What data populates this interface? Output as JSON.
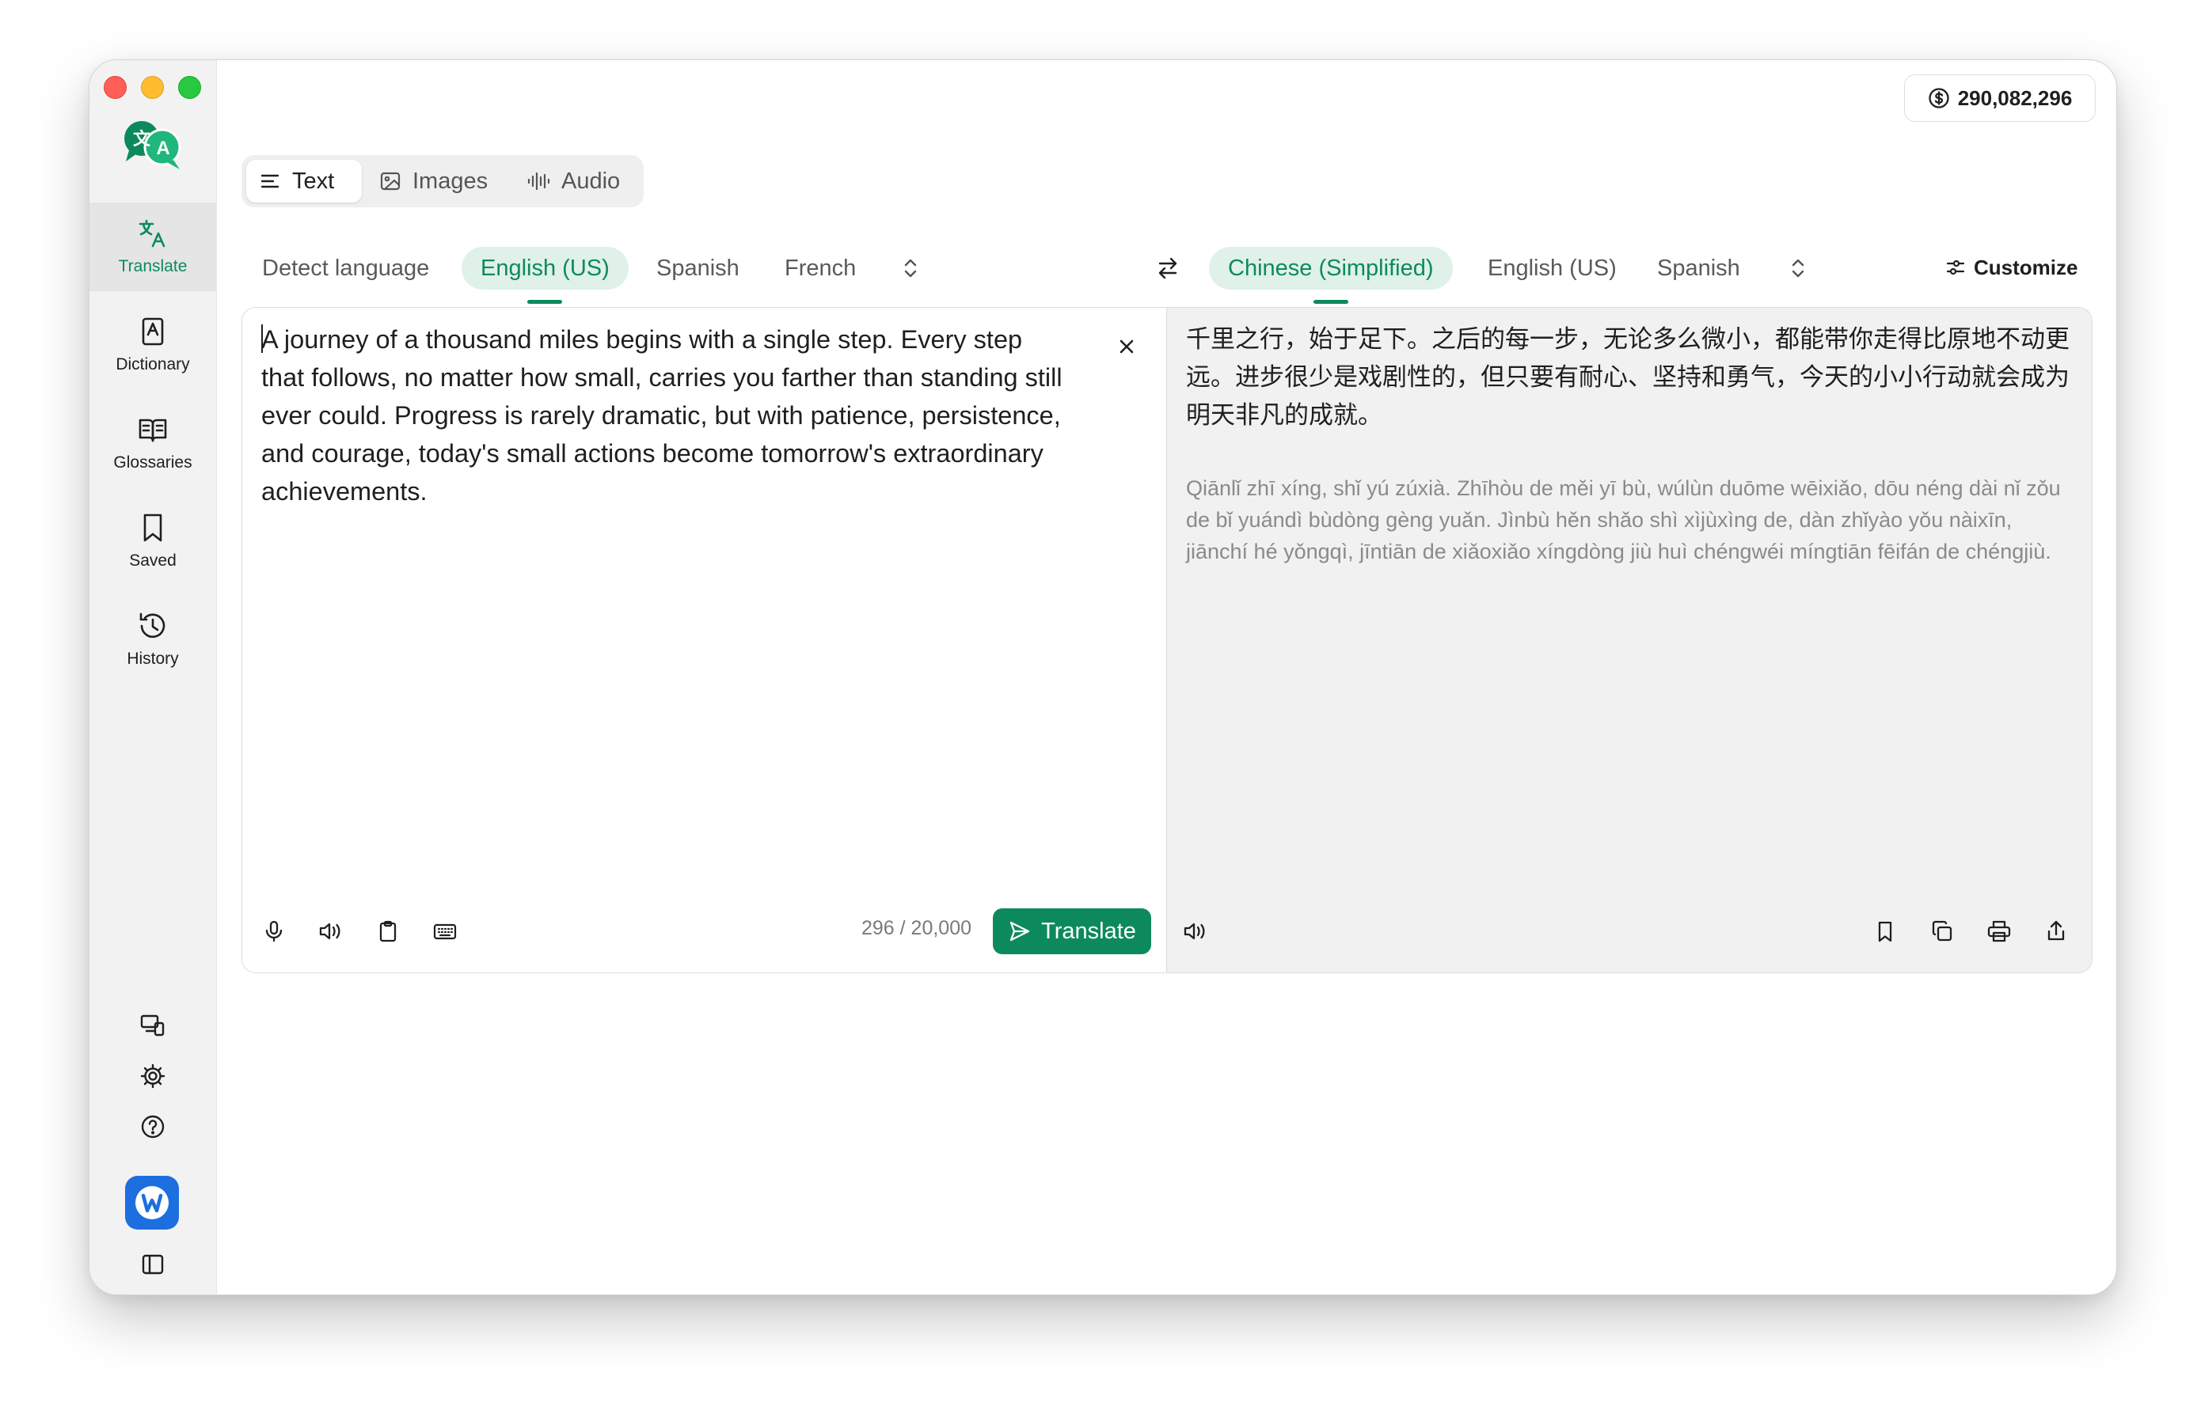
{
  "credits": {
    "value": "290,082,296",
    "icon": "dollar-icon"
  },
  "sidebar": {
    "items": [
      {
        "label": "Translate",
        "icon": "translate-icon"
      },
      {
        "label": "Dictionary",
        "icon": "dictionary-icon"
      },
      {
        "label": "Glossaries",
        "icon": "book-icon"
      },
      {
        "label": "Saved",
        "icon": "bookmark-icon"
      },
      {
        "label": "History",
        "icon": "history-icon"
      }
    ],
    "active": "Translate",
    "tools": [
      "devices-icon",
      "gear-icon",
      "help-icon",
      "brand-icon",
      "sidebar-toggle-icon"
    ]
  },
  "mode_tabs": [
    {
      "label": "Text",
      "icon": "text-lines-icon"
    },
    {
      "label": "Images",
      "icon": "image-icon"
    },
    {
      "label": "Audio",
      "icon": "waveform-icon"
    }
  ],
  "source_languages": [
    "Detect language",
    "English (US)",
    "Spanish",
    "French"
  ],
  "source_selected": "English (US)",
  "target_languages": [
    "Chinese (Simplified)",
    "English (US)",
    "Spanish"
  ],
  "target_selected": "Chinese (Simplified)",
  "customize_label": "Customize",
  "source": {
    "text": "A journey of a thousand miles begins with a single step. Every step that follows, no matter how small, carries you farther than standing still ever could. Progress is rarely dramatic, but with patience, persistence, and courage, today's small actions become tomorrow's extraordinary achievements.",
    "char_count": "296 / 20,000",
    "translate_label": "Translate"
  },
  "target": {
    "text": "千里之行，始于足下。之后的每一步，无论多么微小，都能带你走得比原地不动更远。进步很少是戏剧性的，但只要有耐心、坚持和勇气，今天的小小行动就会成为明天非凡的成就。",
    "pinyin": "Qiānlǐ zhī xíng, shǐ yú zúxià. Zhīhòu de měi yī bù, wúlùn duōme wēixiǎo, dōu néng dài nǐ zǒu de bǐ yuándì bùdòng gèng yuǎn. Jìnbù hěn shǎo shì xìjùxìng de, dàn zhǐyào yǒu nàixīn, jiānchí hé yǒngqì, jīntiān de xiǎoxiǎo xíngdòng jiù huì chéngwéi míngtiān fēifán de chéngjiù."
  },
  "colors": {
    "accent": "#0d8a5b",
    "accent_bg": "#dff1e8",
    "brand": "#1d6fe0"
  }
}
